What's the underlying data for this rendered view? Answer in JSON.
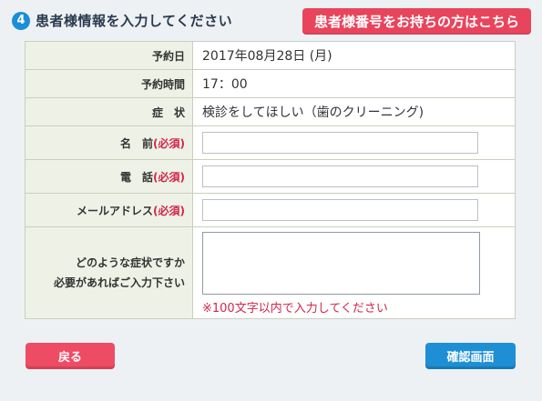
{
  "header": {
    "step_number": "4",
    "title": "患者様情報を入力してください",
    "patient_number_button": "患者様番号をお持ちの方はこちら"
  },
  "form": {
    "date": {
      "label": "予約日",
      "value": "2017年08月28日 (月)"
    },
    "time": {
      "label": "予約時間",
      "value": "17：00"
    },
    "symptom": {
      "label": "症　状",
      "value": "検診をしてほしい（歯のクリーニング)"
    },
    "name": {
      "label": "名　前",
      "required": "(必須)",
      "value": ""
    },
    "phone": {
      "label": "電　話",
      "required": "(必須)",
      "value": ""
    },
    "email": {
      "label": "メールアドレス",
      "required": "(必須)",
      "value": ""
    },
    "details": {
      "label_line1": "どのような症状ですか",
      "label_line2": "必要があればご入力下さい",
      "value": "",
      "note": "※100文字以内で入力してください"
    }
  },
  "footer": {
    "back_button": "戻る",
    "confirm_button": "確認画面"
  },
  "colors": {
    "accent_blue": "#1e8fd4",
    "accent_red": "#e8455d",
    "required_red": "#d3254a"
  }
}
